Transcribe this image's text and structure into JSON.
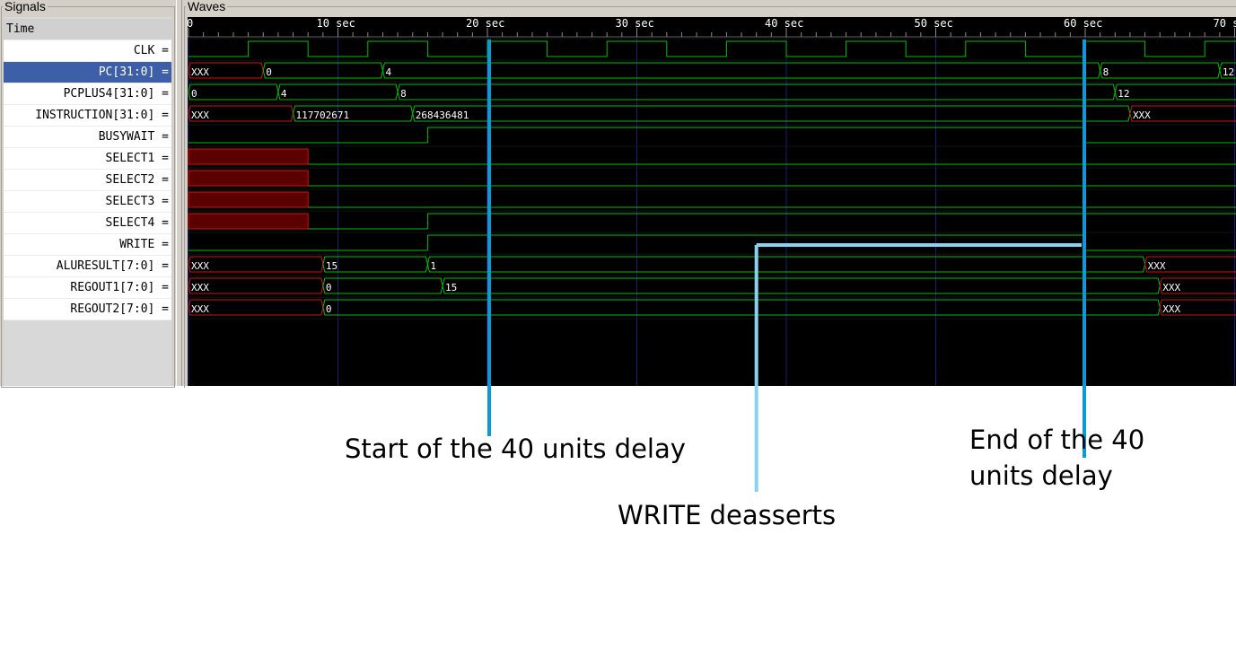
{
  "panels": {
    "signals_title": "Signals",
    "waves_title": "Waves"
  },
  "signal_list": {
    "time_header": "Time",
    "rows": [
      {
        "name": "CLK",
        "suffix": "=",
        "selected": false
      },
      {
        "name": "PC[31:0]",
        "suffix": "=",
        "selected": true
      },
      {
        "name": "PCPLUS4[31:0]",
        "suffix": "=",
        "selected": false
      },
      {
        "name": "INSTRUCTION[31:0]",
        "suffix": "=",
        "selected": false
      },
      {
        "name": "BUSYWAIT",
        "suffix": "=",
        "selected": false
      },
      {
        "name": "SELECT1",
        "suffix": "=",
        "selected": false
      },
      {
        "name": "SELECT2",
        "suffix": "=",
        "selected": false
      },
      {
        "name": "SELECT3",
        "suffix": "=",
        "selected": false
      },
      {
        "name": "SELECT4",
        "suffix": "=",
        "selected": false
      },
      {
        "name": "WRITE",
        "suffix": "=",
        "selected": false
      },
      {
        "name": "ALURESULT[7:0]",
        "suffix": "=",
        "selected": false
      },
      {
        "name": "REGOUT1[7:0]",
        "suffix": "=",
        "selected": false
      },
      {
        "name": "REGOUT2[7:0]",
        "suffix": "=",
        "selected": false
      }
    ]
  },
  "timeline": {
    "unit": "sec",
    "tick_labels": [
      "0",
      "10 sec",
      "20 sec",
      "30 sec",
      "40 sec",
      "50 sec",
      "60 sec",
      "70 s"
    ],
    "clock_half_period": 4
  },
  "waves": [
    {
      "name": "CLK",
      "kind": "clock"
    },
    {
      "name": "PC[31:0]",
      "kind": "bus",
      "segments": [
        {
          "start": 0,
          "value": "XXX",
          "unknown": true
        },
        {
          "start": 5,
          "value": "0"
        },
        {
          "start": 13,
          "value": "4"
        },
        {
          "start": 61,
          "value": "8"
        },
        {
          "start": 69,
          "value": "12"
        }
      ]
    },
    {
      "name": "PCPLUS4[31:0]",
      "kind": "bus",
      "segments": [
        {
          "start": 0,
          "value": "0"
        },
        {
          "start": 6,
          "value": "4"
        },
        {
          "start": 14,
          "value": "8"
        },
        {
          "start": 62,
          "value": "12"
        }
      ]
    },
    {
      "name": "INSTRUCTION[31:0]",
      "kind": "bus",
      "segments": [
        {
          "start": 0,
          "value": "XXX",
          "unknown": true
        },
        {
          "start": 7,
          "value": "117702671"
        },
        {
          "start": 15,
          "value": "268436481"
        },
        {
          "start": 63,
          "value": "XXX",
          "unknown": true
        }
      ]
    },
    {
      "name": "BUSYWAIT",
      "kind": "bit",
      "segments": [
        {
          "start": 0,
          "value": 0
        },
        {
          "start": 16,
          "value": 1
        },
        {
          "start": 60,
          "value": 0
        }
      ]
    },
    {
      "name": "SELECT1",
      "kind": "bit",
      "segments": [
        {
          "start": 0,
          "value": "x"
        },
        {
          "start": 8,
          "value": 0
        }
      ]
    },
    {
      "name": "SELECT2",
      "kind": "bit",
      "segments": [
        {
          "start": 0,
          "value": "x"
        },
        {
          "start": 8,
          "value": 0
        }
      ]
    },
    {
      "name": "SELECT3",
      "kind": "bit",
      "segments": [
        {
          "start": 0,
          "value": "x"
        },
        {
          "start": 8,
          "value": 0
        }
      ]
    },
    {
      "name": "SELECT4",
      "kind": "bit",
      "segments": [
        {
          "start": 0,
          "value": "x"
        },
        {
          "start": 8,
          "value": 0
        },
        {
          "start": 16,
          "value": 1
        }
      ]
    },
    {
      "name": "WRITE",
      "kind": "bit",
      "segments": [
        {
          "start": 0,
          "value": 0
        },
        {
          "start": 16,
          "value": 1
        },
        {
          "start": 60,
          "value": 0
        }
      ]
    },
    {
      "name": "ALURESULT[7:0]",
      "kind": "bus",
      "segments": [
        {
          "start": 0,
          "value": "XXX",
          "unknown": true
        },
        {
          "start": 9,
          "value": "15"
        },
        {
          "start": 16,
          "value": "1"
        },
        {
          "start": 64,
          "value": "XXX",
          "unknown": true
        }
      ]
    },
    {
      "name": "REGOUT1[7:0]",
      "kind": "bus",
      "segments": [
        {
          "start": 0,
          "value": "XXX",
          "unknown": true
        },
        {
          "start": 9,
          "value": "0"
        },
        {
          "start": 17,
          "value": "15"
        },
        {
          "start": 65,
          "value": "XXX",
          "unknown": true
        }
      ]
    },
    {
      "name": "REGOUT2[7:0]",
      "kind": "bus",
      "segments": [
        {
          "start": 0,
          "value": "XXX",
          "unknown": true
        },
        {
          "start": 9,
          "value": "0"
        },
        {
          "start": 65,
          "value": "XXX",
          "unknown": true
        }
      ]
    }
  ],
  "annotations": {
    "start_delay": "Start of the 40 units delay",
    "write_deasserts": "WRITE deasserts",
    "end_delay_line1": "End of the 40",
    "end_delay_line2": "units delay",
    "marker_start_time": 20,
    "marker_end_time": 60,
    "write_marker_time": 38
  },
  "colors": {
    "wave": "#00c000",
    "unknown": "#d01010",
    "unknown_fill": "#5a0000",
    "grid": "#1e1e78",
    "ruler": "#ffffff",
    "marker_dark": "#0a9ad8",
    "marker_light": "#8ad0ef",
    "selected_row": "#3c5fa8"
  }
}
